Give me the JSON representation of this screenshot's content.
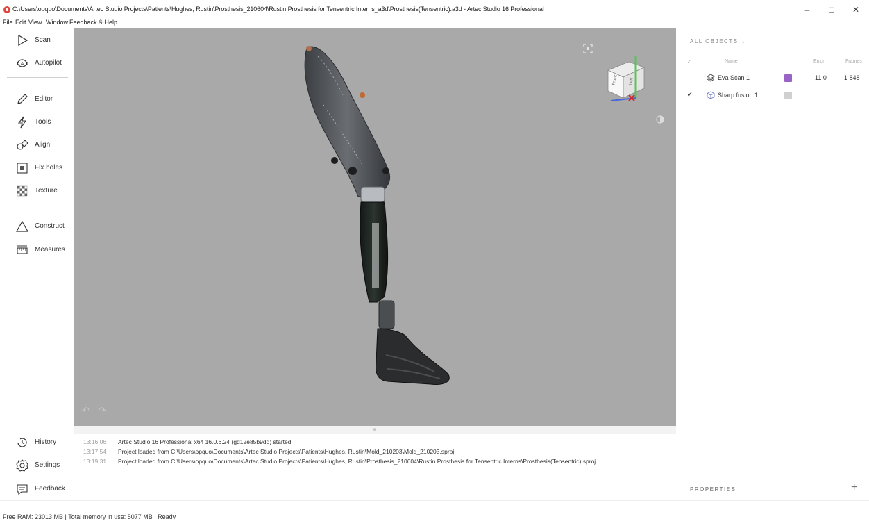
{
  "window": {
    "title": "C:\\Users\\opquo\\Documents\\Artec Studio Projects\\Patients\\Hughes, Rustin\\Prosthesis_210604\\Rustin Prosthesis for Tensentric Interns_a3d\\Prosthesis(Tensentric).a3d - Artec Studio 16 Professional",
    "minimize": "–",
    "maximize": "□",
    "close": "✕"
  },
  "menu": [
    "File",
    "Edit",
    "View",
    "Window",
    "Feedback & Help"
  ],
  "sidebar": {
    "top_tools": [
      {
        "label": "Scan",
        "icon": "play-outline-icon"
      },
      {
        "label": "Autopilot",
        "icon": "autopilot-icon"
      }
    ],
    "process_tools": [
      {
        "label": "Editor",
        "icon": "pencil-icon"
      },
      {
        "label": "Tools",
        "icon": "lightning-icon"
      },
      {
        "label": "Align",
        "icon": "align-icon"
      },
      {
        "label": "Fix holes",
        "icon": "fix-holes-icon"
      },
      {
        "label": "Texture",
        "icon": "texture-icon"
      }
    ],
    "measure_tools": [
      {
        "label": "Construct",
        "icon": "triangle-icon"
      },
      {
        "label": "Measures",
        "icon": "ruler-icon"
      }
    ],
    "bottom_tools": [
      {
        "label": "History",
        "icon": "history-icon"
      },
      {
        "label": "Settings",
        "icon": "gear-icon"
      },
      {
        "label": "Feedback",
        "icon": "chat-icon"
      }
    ]
  },
  "viewport": {
    "undo": "↶",
    "redo": "↷",
    "cube_labels": {
      "front": "Front",
      "left": "Left"
    }
  },
  "log": {
    "handle": "≡",
    "entries": [
      {
        "time": "13:16:06",
        "message": "Artec Studio 16 Professional x64 16.0.6.24 (gd12e85b9dd) started"
      },
      {
        "time": "13:17:54",
        "message": "Project loaded from C:\\Users\\opquo\\Documents\\Artec Studio Projects\\Patients\\Hughes, Rustin\\Mold_210203\\Mold_210203.sproj"
      },
      {
        "time": "13:19:31",
        "message": "Project loaded from C:\\Users\\opquo\\Documents\\Artec Studio Projects\\Patients\\Hughes, Rustin\\Prosthesis_210604\\Rustin Prosthesis for Tensentric Interns\\Prosthesis(Tensentric).sproj"
      }
    ]
  },
  "objects_panel": {
    "header": "ALL OBJECTS ⌄",
    "columns": {
      "check": "✓",
      "name": "Name",
      "error": "Error",
      "frames": "Frames"
    },
    "rows": [
      {
        "check": "",
        "name": "Eva Scan 1",
        "color": "#9a63c8",
        "error": "11.0",
        "frames": "1 848",
        "icon": "scan-layers-icon"
      },
      {
        "check": "✔",
        "name": "Sharp fusion 1",
        "color": "#d0d0d0",
        "error": "",
        "frames": "",
        "icon": "cube-model-icon"
      }
    ],
    "properties_header": "PROPERTIES",
    "properties_add": "+",
    "handle": "≡"
  },
  "status": {
    "text": "Free RAM: 23013 MB  |  Total memory in use: 5077 MB  |   Ready"
  },
  "colors": {
    "accent_red": "#e2453c",
    "viewport_bg": "#a9a9a9",
    "scan_purple": "#9a63c8"
  }
}
